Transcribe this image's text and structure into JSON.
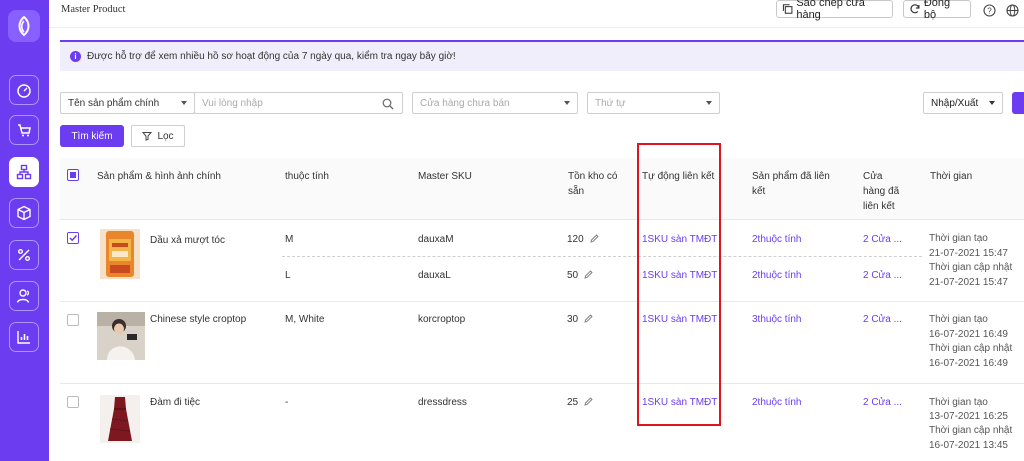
{
  "topbar": {
    "title": "Master Product",
    "copy_button": "Sao chép cửa hàng",
    "sync_button": "Đồng bộ",
    "help_icon": "help-circle-icon",
    "language_icon": "globe-icon"
  },
  "banner": {
    "message": "Được hỗ trợ để xem nhiều hồ sơ hoạt động của 7 ngày qua, kiểm tra ngay bây giờ!"
  },
  "filters": {
    "search_field_select": "Tên sản phẩm chính",
    "search_placeholder": "Vui lòng nhập",
    "store_placeholder": "Cửa hàng chưa bán",
    "order_placeholder": "Thứ tự",
    "import_export": "Nhập/Xuất",
    "search_button": "Tìm kiếm",
    "filter_button": "Lọc"
  },
  "table": {
    "headers": {
      "product": "Sản phẩm & hình ảnh chính",
      "attribute": "thuộc tính",
      "sku": "Master SKU",
      "stock_line1": "Tồn kho có",
      "stock_line2": "sẵn",
      "auto_link": "Tự động liên kết",
      "linked_product_line1": "Sản phẩm đã liên",
      "linked_product_line2": "kết",
      "linked_store_line1": "Cửa",
      "linked_store_line2": "hàng đã",
      "linked_store_line3": "liên kết",
      "time": "Thời gian"
    },
    "rows": [
      {
        "checked": true,
        "name": "Dầu xả mượt tóc",
        "variants": [
          {
            "attribute": "M",
            "sku": "dauxaM",
            "stock": "120",
            "auto_link": "1SKU sàn TMĐT",
            "linked_products": "2thuộc tính",
            "linked_stores": "2 Cửa ..."
          },
          {
            "attribute": "L",
            "sku": "dauxaL",
            "stock": "50",
            "auto_link": "1SKU sàn TMĐT",
            "linked_products": "2thuộc tính",
            "linked_stores": "2 Cửa ..."
          }
        ],
        "created_label": "Thời gian tạo",
        "created": "21-07-2021 15:47",
        "updated_label": "Thời gian cập nhật",
        "updated": "21-07-2021 15:47"
      },
      {
        "checked": false,
        "name": "Chinese style croptop",
        "variants": [
          {
            "attribute": "M, White",
            "sku": "korcroptop",
            "stock": "30",
            "auto_link": "1SKU sàn TMĐT",
            "linked_products": "3thuộc tính",
            "linked_stores": "2 Cửa ..."
          }
        ],
        "created_label": "Thời gian tạo",
        "created": "16-07-2021 16:49",
        "updated_label": "Thời gian cập nhật",
        "updated": "16-07-2021 16:49"
      },
      {
        "checked": false,
        "name": "Đàm đi tiệc",
        "variants": [
          {
            "attribute": "-",
            "sku": "dressdress",
            "stock": "25",
            "auto_link": "1SKU sàn TMĐT",
            "linked_products": "2thuộc tính",
            "linked_stores": "2 Cửa ..."
          }
        ],
        "created_label": "Thời gian tạo",
        "created": "13-07-2021 16:25",
        "updated_label": "Thời gian cập nhật",
        "updated": "16-07-2021 13:45"
      }
    ]
  },
  "sidebar": {
    "icons": [
      "logo-icon",
      "dashboard-icon",
      "cart-icon",
      "product-hierarchy-icon",
      "box-icon",
      "percent-icon",
      "users-icon",
      "chart-icon"
    ],
    "active": "product-hierarchy-icon"
  },
  "colors": {
    "accent": "#6b3cf0",
    "highlight": "#e0141e"
  }
}
